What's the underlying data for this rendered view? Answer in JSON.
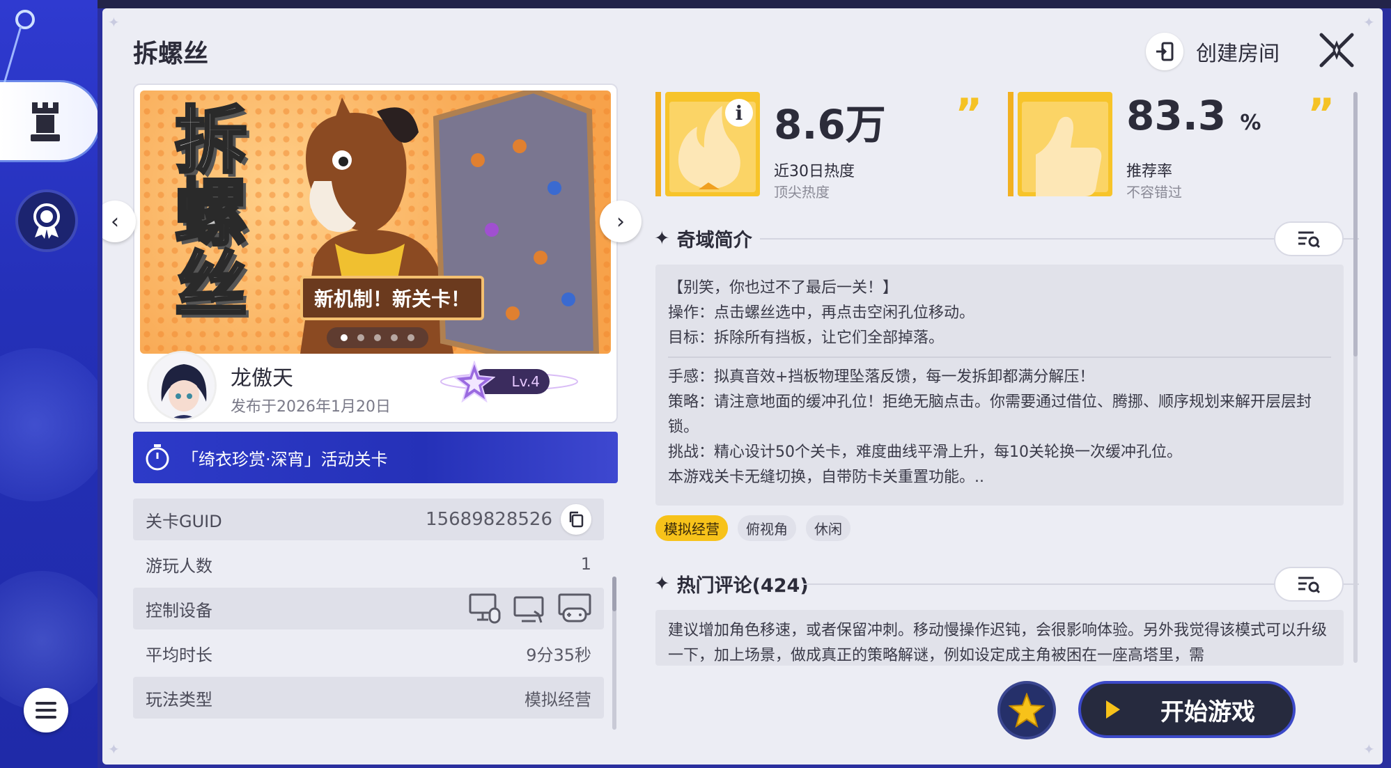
{
  "sidebar": {
    "active_tab_icon": "chess-rook-icon",
    "badge_icon": "award-ribbon-icon",
    "menu_icon": "hamburger-menu-icon"
  },
  "header": {
    "title": "拆螺丝",
    "create_room_label": "创建房间",
    "create_room_icon": "door-enter-icon",
    "close_icon": "close-x-icon"
  },
  "banner": {
    "art_title": "拆螺丝",
    "art_tagline": "新机制！新关卡！",
    "pages": 5,
    "current_page": 1
  },
  "author": {
    "name": "龙傲天",
    "published": "发布于2026年1月20日",
    "level": "Lv.4"
  },
  "event": {
    "icon": "stopwatch-icon",
    "label": "「绮衣珍赏·深宵」活动关卡"
  },
  "info": {
    "guid_label": "关卡GUID",
    "guid_value": "15689828526",
    "players_label": "游玩人数",
    "players_value": "1",
    "device_label": "控制设备",
    "devices": [
      "pc-mouse-icon",
      "pc-touch-icon",
      "gamepad-icon"
    ],
    "duration_label": "平均时长",
    "duration_value": "9分35秒",
    "genre_label": "玩法类型",
    "genre_value": "模拟经营",
    "next_label_cut": "..."
  },
  "stats": {
    "heat_value": "8.6万",
    "heat_label": "近30日热度",
    "heat_sub": "顶尖热度",
    "rec_value": "83.3",
    "rec_unit": "%",
    "rec_label": "推荐率",
    "rec_sub": "不容错过"
  },
  "intro": {
    "header": "奇域简介",
    "lines_a": [
      "【别笑，你也过不了最后一关！】",
      "操作：点击螺丝选中，再点击空闲孔位移动。",
      "目标：拆除所有挡板，让它们全部掉落。"
    ],
    "lines_b": [
      "手感：拟真音效+挡板物理坠落反馈，每一发拆卸都满分解压！",
      "策略：请注意地面的缓冲孔位！拒绝无脑点击。你需要通过借位、腾挪、顺序规划来解开层层封锁。",
      "挑战：精心设计50个关卡，难度曲线平滑上升，每10关轮换一次缓冲孔位。",
      "本游戏关卡无缝切换，自带防卡关重置功能。.."
    ],
    "tags": [
      "模拟经营",
      "俯视角",
      "休闲"
    ]
  },
  "comments": {
    "header": "热门评论(424)",
    "first": "建议增加角色移速，或者保留冲刺。移动慢操作迟钝，会很影响体验。另外我觉得该模式可以升级一下，加上场景，做成真正的策略解谜，例如设定成主角被困在一座高塔里，需"
  },
  "actions": {
    "favorite_icon": "star-icon",
    "start_label": "开始游戏",
    "start_icon": "play-icon"
  },
  "colors": {
    "accent_blue": "#2d3ac8",
    "tag_yellow": "#f7c21a",
    "panel_bg": "#ecedf4"
  }
}
